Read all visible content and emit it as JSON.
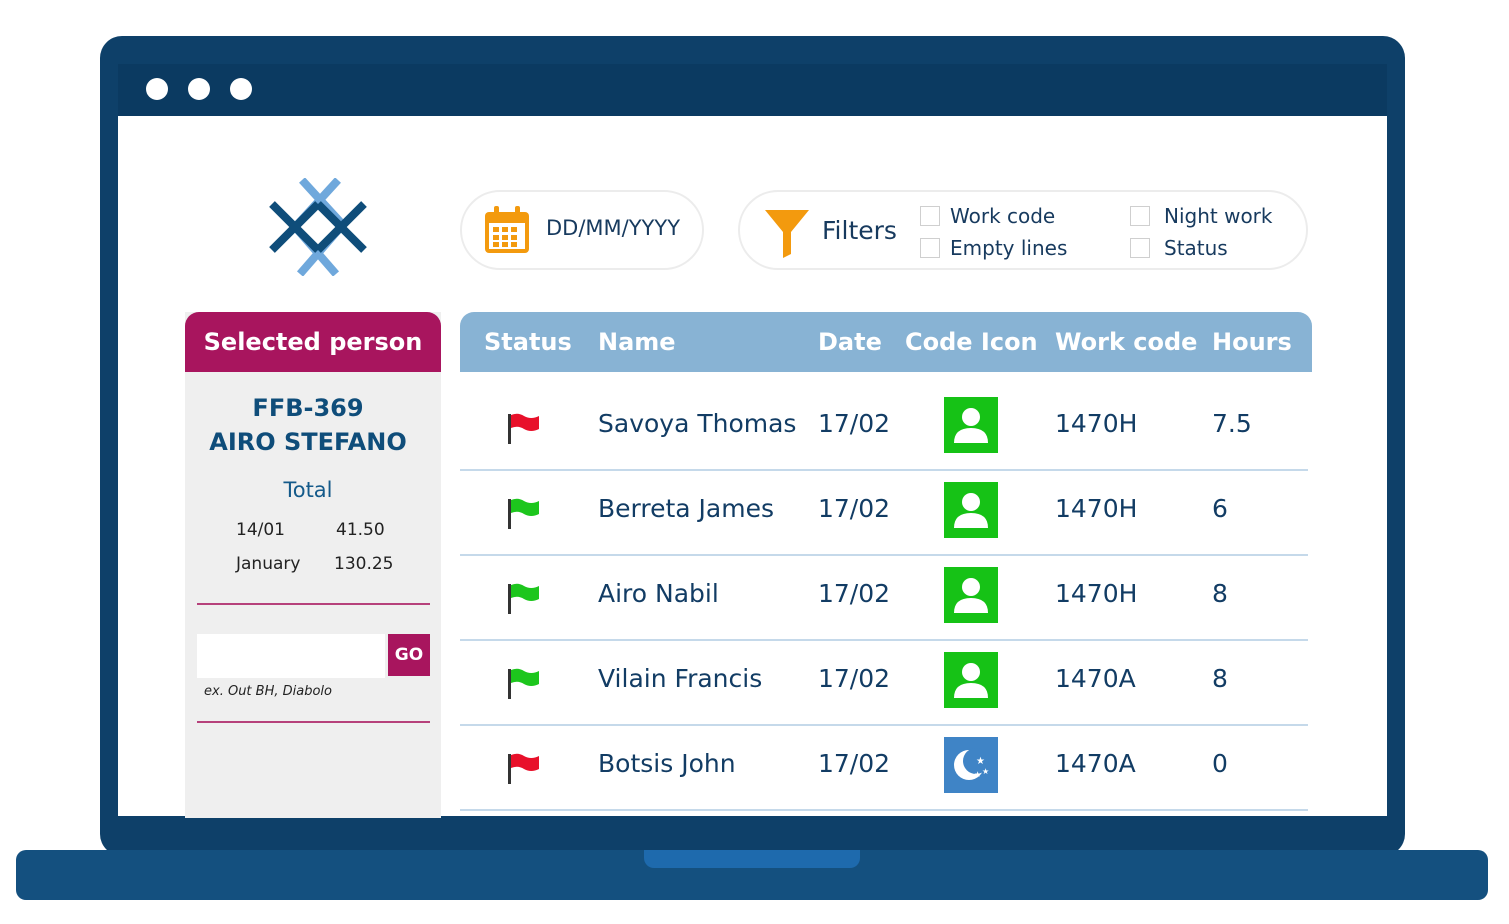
{
  "filters": {
    "date_placeholder": "DD/MM/YYYY",
    "label": "Filters",
    "options": [
      "Work code",
      "Empty lines",
      "Night work",
      "Status"
    ]
  },
  "person": {
    "header": "Selected person",
    "code": "FFB-369",
    "name": "AIRO STEFANO",
    "total_label": "Total",
    "totals": [
      {
        "period": "14/01",
        "value": "41.50"
      },
      {
        "period": "January",
        "value": "130.25"
      }
    ],
    "search_value": "",
    "go_label": "GO",
    "hint": "ex. Out BH, Diabolo"
  },
  "table": {
    "columns": [
      "Status",
      "Name",
      "Date",
      "Code Icon",
      "Work code",
      "Hours"
    ],
    "rows": [
      {
        "status": "red-flag",
        "name": "Savoya Thomas",
        "date": "17/02",
        "code_icon": "person-icon",
        "work_code": "1470H",
        "hours": "7.5"
      },
      {
        "status": "green-flag",
        "name": "Berreta James",
        "date": "17/02",
        "code_icon": "person-icon",
        "work_code": "1470H",
        "hours": "6"
      },
      {
        "status": "green-flag",
        "name": "Airo Nabil",
        "date": "17/02",
        "code_icon": "person-icon",
        "work_code": "1470H",
        "hours": "8"
      },
      {
        "status": "green-flag",
        "name": "Vilain Francis",
        "date": "17/02",
        "code_icon": "person-icon",
        "work_code": "1470A",
        "hours": "8"
      },
      {
        "status": "red-flag",
        "name": "Botsis John",
        "date": "17/02",
        "code_icon": "moon-stars-icon",
        "work_code": "1470A",
        "hours": "0"
      }
    ]
  },
  "colors": {
    "frame": "#0e4069",
    "accent": "#a8155e",
    "table_header": "#88b3d4",
    "flag_red": "#e8102a",
    "flag_green": "#1dc61d",
    "icon_green": "#16c216",
    "icon_blue": "#3f84c6",
    "filter_orange": "#f39a0e"
  }
}
